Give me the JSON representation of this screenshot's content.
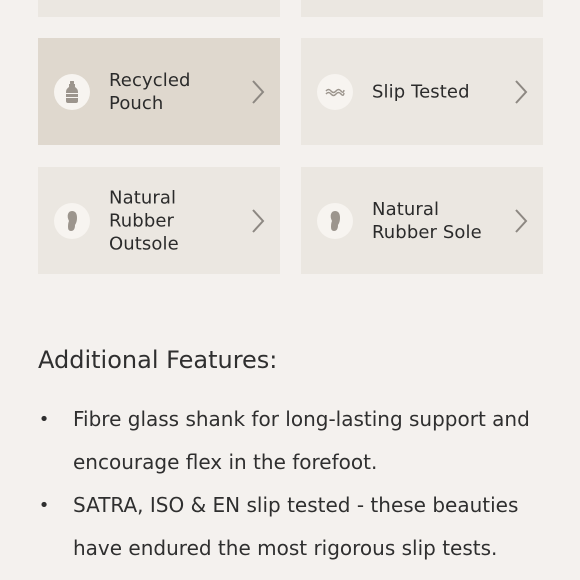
{
  "feature_tiles": [
    {
      "label": "Recycled Pouch",
      "icon": "bottle-icon",
      "selected": true
    },
    {
      "label": "Slip Tested",
      "icon": "wave-icon",
      "selected": false
    },
    {
      "label": "Natural Rubber Outsole",
      "icon": "footprint-icon",
      "selected": false
    },
    {
      "label": "Natural Rubber Sole",
      "icon": "footprint-icon",
      "selected": false
    }
  ],
  "additional_features": {
    "title": "Additional Features:",
    "items": [
      "Fibre glass shank for long-lasting support and encourage flex in the forefoot.",
      "SATRA, ISO & EN slip tested - these beauties have endured the most rigorous slip tests."
    ]
  },
  "colors": {
    "background": "#f4f1ee",
    "tile": "#ebe7e1",
    "tile_selected": "#dfd8ce",
    "icon_circle": "#f7f4f0",
    "icon": "#9c958d",
    "chevron": "#8d8882"
  }
}
